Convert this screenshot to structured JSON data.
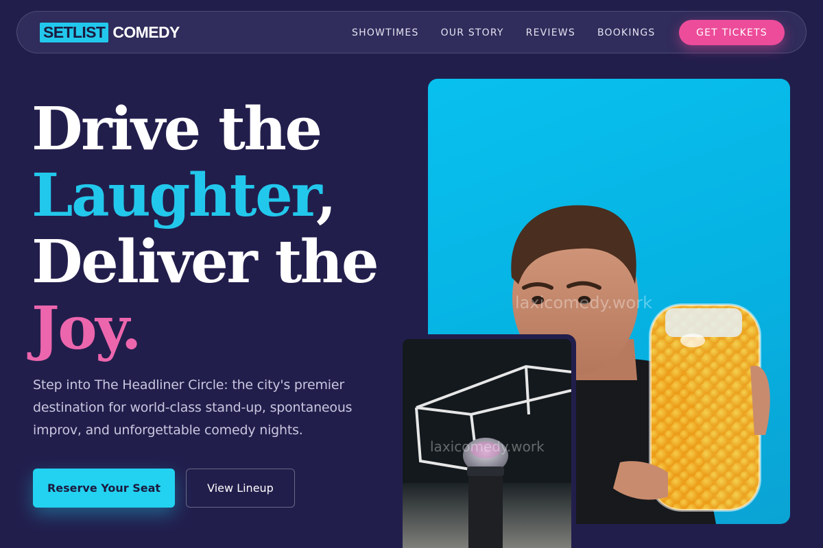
{
  "brand": {
    "name_box": "SETLIST",
    "name_rest": "COMEDY",
    "colors": {
      "background": "#221e4c",
      "accent_cyan": "#22c8ec",
      "accent_pink": "#ec66ad",
      "cta_pink": "#ed4c9a"
    }
  },
  "nav": {
    "links": [
      "SHOWTIMES",
      "OUR STORY",
      "REVIEWS",
      "BOOKINGS"
    ],
    "cta_label": "GET TICKETS"
  },
  "hero": {
    "headline": {
      "line1": "Drive the",
      "line2_highlight": "Laughter",
      "line2_comma": ",",
      "line3": "Deliver the",
      "line4_highlight": "Joy",
      "line4_period": "."
    },
    "lead": "Step into The Headliner Circle: the city's premier destination for world-class stand-up, spontaneous improv, and unforgettable comedy nights.",
    "primary_button": "Reserve Your Seat",
    "secondary_button": "View Lineup"
  },
  "images": {
    "main_photo": {
      "icon": "comedian-with-jar-photo",
      "watermark": "laxicomedy.work"
    },
    "secondary_photo": {
      "icon": "microphone-neon-photo",
      "watermark": "laxicomedy.work"
    }
  }
}
